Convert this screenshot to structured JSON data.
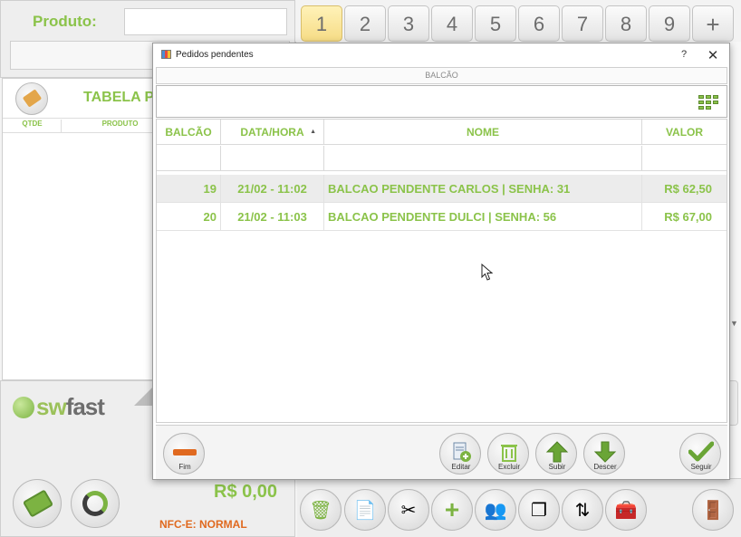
{
  "background": {
    "product_label": "Produto:",
    "table_title": "TABELA PA",
    "columns": [
      "QTDE",
      "PRODUTO"
    ],
    "logo": {
      "prefix": "sw",
      "suffix": "fast"
    },
    "total": "R$ 0,00",
    "nfce_status": "NFC-E: NORMAL",
    "tabs": [
      "1",
      "2",
      "3",
      "4",
      "5",
      "6",
      "7",
      "8",
      "9",
      "+"
    ],
    "active_tab": "1"
  },
  "dialog": {
    "title": "Pedidos pendentes",
    "help": "?",
    "close": "✕",
    "section_header": "BALCÃO",
    "search": {
      "value": "",
      "placeholder": ""
    },
    "table": {
      "headers": {
        "balcao": "BALCÃO",
        "data_hora": "DATA/HORA",
        "nome": "NOME",
        "valor": "VALOR"
      },
      "sort_indicator": "▲",
      "rows": [
        {
          "balcao": "19",
          "data_hora": "21/02 - 11:02",
          "nome": "BALCAO PENDENTE CARLOS | SENHA: 31",
          "valor": "R$ 62,50",
          "selected": true
        },
        {
          "balcao": "20",
          "data_hora": "21/02 - 11:03",
          "nome": "BALCAO PENDENTE DULCI | SENHA: 56",
          "valor": "R$ 67,00",
          "selected": false
        }
      ]
    },
    "footer": {
      "fim": "Fim",
      "editar": "Editar",
      "excluir": "Excluir",
      "subir": "Subir",
      "descer": "Descer",
      "seguir": "Seguir"
    }
  },
  "colors": {
    "accent_green": "#8bc34a",
    "orange": "#e0691f",
    "tab_active": "#f6dc86"
  }
}
